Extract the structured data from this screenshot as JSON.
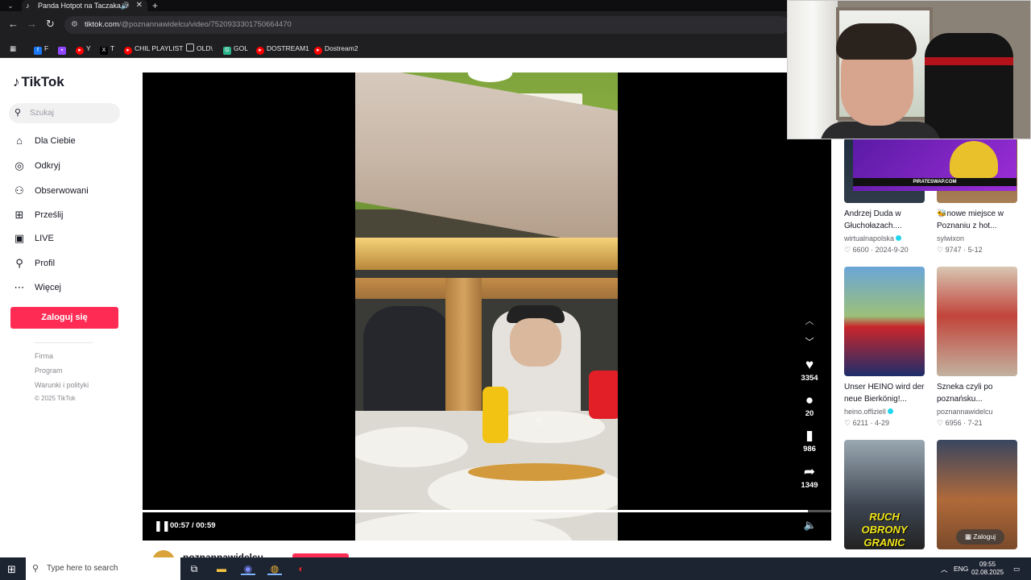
{
  "browser": {
    "tab_title": "Panda Hotpot na Taczaka w",
    "url_domain": "tiktok.com",
    "url_path": "/@poznannawidelcu/video/7520933301750664470",
    "bookmarks": [
      "F",
      "",
      "Y",
      "T",
      "CHIL PLAYLIST",
      "OLD\\",
      "GOL",
      "DOSTREAM1",
      "Dostream2"
    ]
  },
  "sidebar": {
    "logo": "TikTok",
    "search_placeholder": "Szukaj",
    "items": [
      {
        "label": "Dla Ciebie",
        "icon": "home-icon"
      },
      {
        "label": "Odkryj",
        "icon": "compass-icon"
      },
      {
        "label": "Obserwowani",
        "icon": "following-icon"
      },
      {
        "label": "Prześlij",
        "icon": "upload-icon"
      },
      {
        "label": "LIVE",
        "icon": "live-icon"
      },
      {
        "label": "Profil",
        "icon": "profile-icon"
      },
      {
        "label": "Więcej",
        "icon": "more-icon"
      }
    ],
    "login_label": "Zaloguj się",
    "footer": [
      "Firma",
      "Program",
      "Warunki i polityki"
    ],
    "copyright": "© 2025 TikTok"
  },
  "video": {
    "likes": "3354",
    "comments": "20",
    "saves": "986",
    "shares": "1349",
    "time_current": "00:57",
    "time_total": "00:59",
    "progress": 0.966,
    "author": "poznannawidelcu",
    "avatar_letter": "P"
  },
  "recommended": [
    {
      "title": "Andrzej Duda w Głuchołazach....",
      "user": "wirtualnapolska",
      "verified": true,
      "likes": "6600",
      "date": "2024-9-20"
    },
    {
      "title": "🐝nowe miejsce w Poznaniu z hot...",
      "user": "sylwixon",
      "verified": false,
      "likes": "9747",
      "date": "5-12"
    },
    {
      "title": "Unser HEINO wird der neue Bierkönig!...",
      "user": "heino.offiziell",
      "verified": true,
      "likes": "6211",
      "date": "4-29"
    },
    {
      "title": "Szneka czyli po poznańsku...",
      "user": "poznannawidelcu",
      "verified": false,
      "likes": "6956",
      "date": "7-21"
    },
    {
      "thumb_text": "RUCH OBRONY GRANIC"
    },
    {}
  ],
  "banner_text": "PIRATESWAP.COM",
  "rail_login_label": "Zaloguj",
  "taskbar": {
    "search_placeholder": "Type here to search",
    "lang": "ENG",
    "time": "09:55",
    "date": "02.08.2025"
  }
}
